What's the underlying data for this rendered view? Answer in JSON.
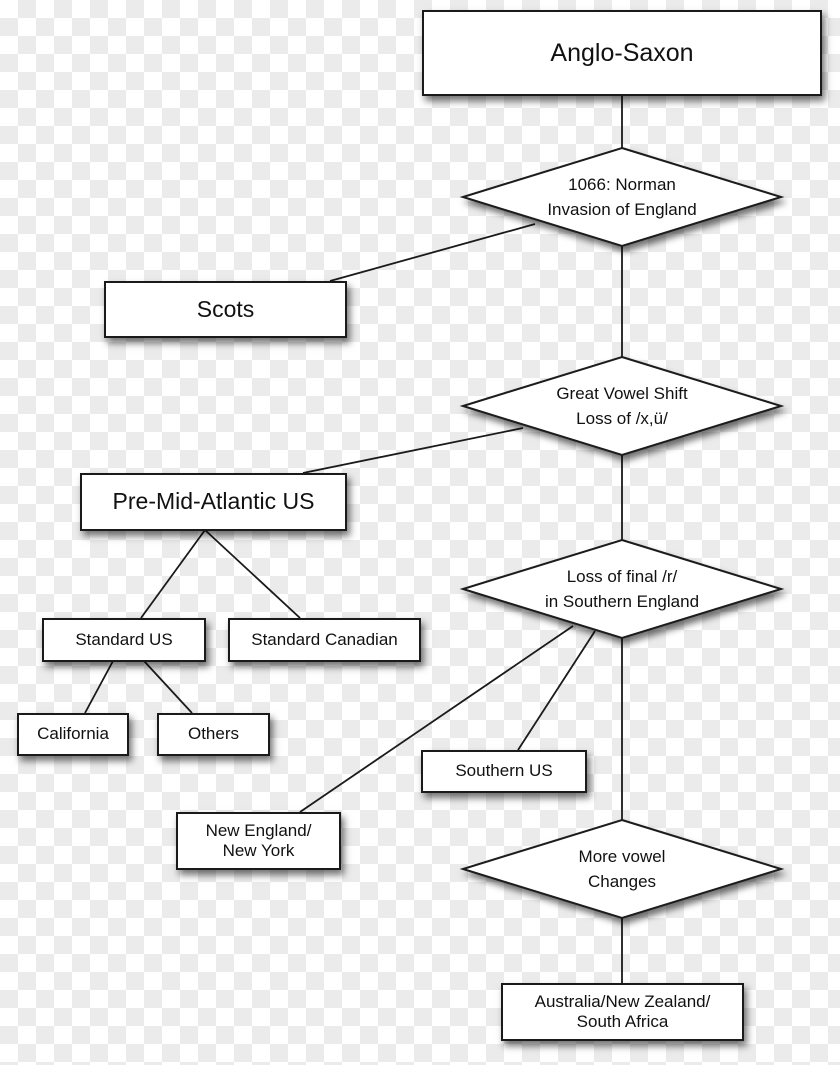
{
  "diagram": {
    "title": "Anglo-Saxon",
    "nodes": {
      "anglo_saxon": "Anglo-Saxon",
      "norman": {
        "line1": "1066: Norman",
        "line2": "Invasion of England"
      },
      "scots": "Scots",
      "great_vowel_shift": {
        "line1": "Great Vowel Shift",
        "line2": "Loss of /x,ü/"
      },
      "pre_mid_atlantic": "Pre-Mid-Atlantic US",
      "standard_us": "Standard US",
      "standard_canadian": "Standard Canadian",
      "california": "California",
      "others": "Others",
      "loss_final_r": {
        "line1": "Loss of final /r/",
        "line2": "in Southern England"
      },
      "southern_us": "Southern US",
      "new_england": {
        "line1": "New England/",
        "line2": "New York"
      },
      "more_vowel": {
        "line1": "More vowel",
        "line2": "Changes"
      },
      "australia": {
        "line1": "Australia/New Zealand/",
        "line2": "South Africa"
      }
    },
    "edges": [
      [
        "Anglo-Saxon",
        "1066: Norman Invasion of England"
      ],
      [
        "1066: Norman Invasion of England",
        "Scots"
      ],
      [
        "1066: Norman Invasion of England",
        "Great Vowel Shift Loss of /x,ü/"
      ],
      [
        "Great Vowel Shift Loss of /x,ü/",
        "Pre-Mid-Atlantic US"
      ],
      [
        "Great Vowel Shift Loss of /x,ü/",
        "Loss of final /r/ in Southern England"
      ],
      [
        "Pre-Mid-Atlantic US",
        "Standard US"
      ],
      [
        "Pre-Mid-Atlantic US",
        "Standard Canadian"
      ],
      [
        "Standard US",
        "California"
      ],
      [
        "Standard US",
        "Others"
      ],
      [
        "Loss of final /r/ in Southern England",
        "New England/New York"
      ],
      [
        "Loss of final /r/ in Southern England",
        "Southern US"
      ],
      [
        "Loss of final /r/ in Southern England",
        "More vowel Changes"
      ],
      [
        "More vowel Changes",
        "Australia/New Zealand/South Africa"
      ]
    ]
  }
}
